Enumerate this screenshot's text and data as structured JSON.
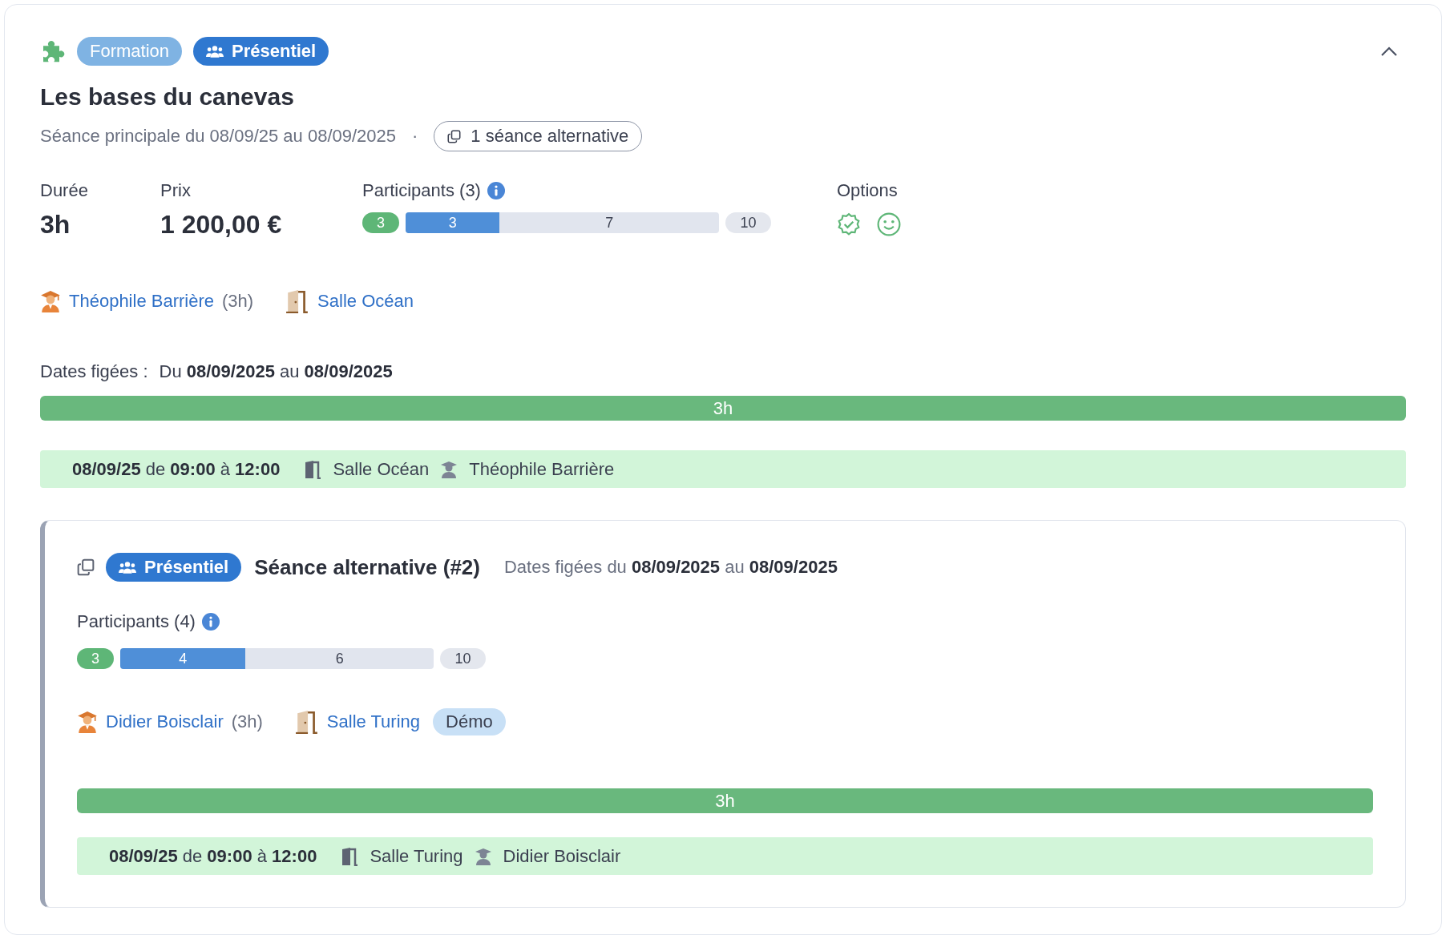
{
  "header": {
    "badges": [
      {
        "kind": "category",
        "label": "Formation"
      },
      {
        "kind": "mode",
        "label": "Présentiel"
      }
    ],
    "expanded": true
  },
  "title": "Les bases du canevas",
  "subtitle": "Séance principale du 08/09/25 au 08/09/2025",
  "separator": "·",
  "alternatives_button": "1 séance alternative",
  "stats": [
    {
      "label": "Durée",
      "value": "3h"
    },
    {
      "label": "Prix",
      "value": "1 200,00 €"
    }
  ],
  "participants": {
    "label": "Participants (3)",
    "minimum": "3",
    "registered": "3",
    "remaining": "7",
    "capacity": "10",
    "level": 0.3
  },
  "options": {
    "label": "Options"
  },
  "resources": {
    "trainer": "Théophile Barrière",
    "trainer_hours": "(3h)",
    "room": "Salle Océan"
  },
  "frozen_dates": {
    "label": "Dates figées :",
    "text": "Du **08/09/2025** au **08/09/2025**"
  },
  "duration_bar": "3h",
  "slots": [
    {
      "time": "**08/09/25** de **09:00** à **12:00**",
      "room": "Salle Océan",
      "trainer": "Théophile Barrière"
    }
  ],
  "alternative": {
    "mode_badge": "Présentiel",
    "title": "Séance alternative (#2)",
    "dates": "Dates figées du **08/09/2025** au **08/09/2025**",
    "participants": {
      "label": "Participants (4)",
      "minimum": "3",
      "registered": "4",
      "remaining": "6",
      "capacity": "10",
      "level": 0.4
    },
    "resources": {
      "trainer": "Didier Boisclair",
      "trainer_hours": "(3h)",
      "room": "Salle Turing",
      "tag": "Démo"
    },
    "duration_bar": "3h",
    "slots": [
      {
        "time": "**08/09/25** de **09:00** à **12:00**",
        "room": "Salle Turing",
        "trainer": "Didier Boisclair"
      }
    ]
  }
}
